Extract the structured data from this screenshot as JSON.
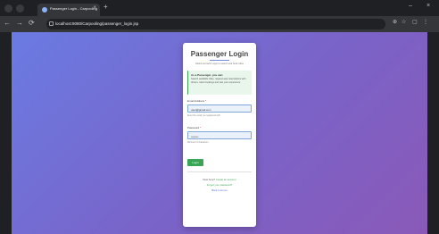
{
  "browser": {
    "tab_title": "Passenger Login - Carpooling",
    "tab_close": "×",
    "new_tab": "+",
    "url": "localhost:8080/Carpooling/passenger_login.jsp",
    "nav_back": "←",
    "nav_forward": "→",
    "nav_reload": "⟳",
    "window_min": "–",
    "window_close": "×"
  },
  "login": {
    "title": "Passenger Login",
    "subtitle": "Welcome back! Login to search and book rides",
    "info": {
      "title": "As a Passenger, you can:",
      "text": "Search available rides, request seat reservations with drivers, track bookings and rate your experience"
    },
    "email": {
      "label": "Email Address",
      "required": "*",
      "value": "user@gmail.com",
      "hint": "Enter the email you registered with"
    },
    "password": {
      "label": "Password",
      "required": "*",
      "value": "••••••••",
      "hint": "Minimum 6 characters"
    },
    "login_button": "Login",
    "new_here": "New here?",
    "create_account": "Create an account",
    "forgot_password": "Forgot your password?",
    "back_home": "Back to Home"
  },
  "colors": {
    "accent": "#3aa655",
    "gradient_start": "#6a7be2",
    "gradient_end": "#8a59b8"
  }
}
